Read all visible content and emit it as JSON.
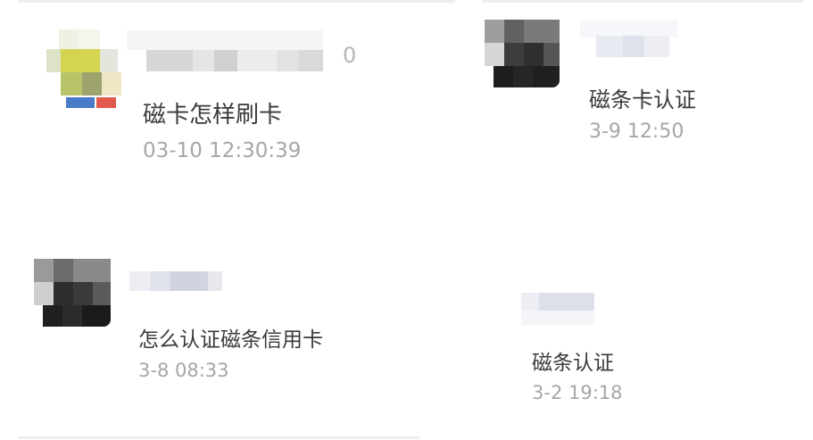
{
  "comments": [
    {
      "message": "磁卡怎样刷卡",
      "timestamp": "03-10 12:30:39",
      "like_count": "0"
    },
    {
      "message": "磁条卡认证",
      "timestamp": "3-9 12:50"
    },
    {
      "message": "怎么认证磁条信用卡",
      "timestamp": "3-8 08:33"
    },
    {
      "message": "磁条认证",
      "timestamp": "3-2 19:18"
    }
  ],
  "colors": {
    "message_text": "#3a3a3a",
    "timestamp_text": "#a6a6a6",
    "background": "#ffffff"
  }
}
